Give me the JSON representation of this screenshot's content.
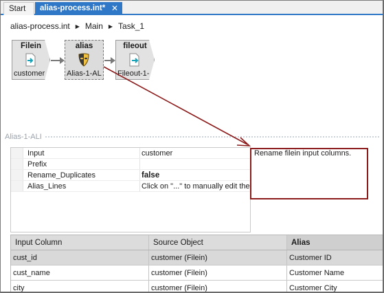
{
  "tabs": [
    {
      "label": "Start"
    },
    {
      "label": "alias-process.int*",
      "close": "✕"
    }
  ],
  "breadcrumb": [
    "alias-process.int",
    "Main",
    "Task_1"
  ],
  "canvas": {
    "nodes": [
      {
        "title": "Filein",
        "label": "customer",
        "icon": "file-in-icon"
      },
      {
        "title": "alias",
        "label": "Alias-1-AL",
        "icon": "mask-icon"
      },
      {
        "title": "fileout",
        "label": "Fileout-1-",
        "icon": "file-out-icon"
      }
    ]
  },
  "section": {
    "title": "Alias-1-ALI"
  },
  "properties": [
    {
      "name": "Input",
      "value": "customer"
    },
    {
      "name": "Prefix",
      "value": ""
    },
    {
      "name": "Rename_Duplicates",
      "value": "false"
    },
    {
      "name": "Alias_Lines",
      "value": "Click on \"...\" to manually edit the a"
    }
  ],
  "description": "Rename filein input columns.",
  "colors": {
    "accent": "#2f78c8",
    "annotation": "#8b1a1a"
  },
  "table": {
    "columns": [
      "Input Column",
      "Source Object",
      "Alias"
    ],
    "rows": [
      [
        "cust_id",
        "customer (Filein)",
        "Customer ID"
      ],
      [
        "cust_name",
        "customer (Filein)",
        "Customer Name"
      ],
      [
        "city",
        "customer (Filein)",
        "Customer City"
      ]
    ]
  }
}
